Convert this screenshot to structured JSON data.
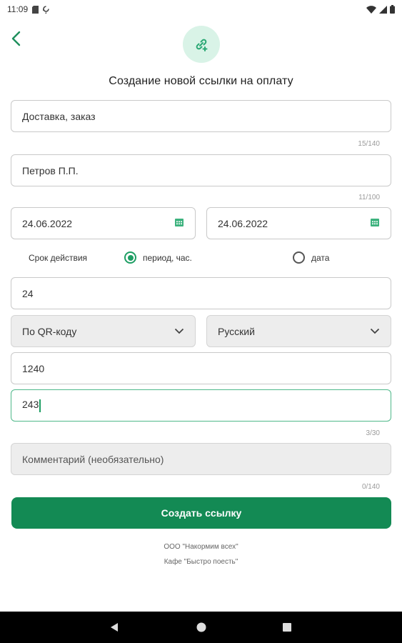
{
  "status_bar": {
    "time": "11:09"
  },
  "header": {
    "title": "Создание новой ссылки на оплату"
  },
  "form": {
    "purpose": {
      "value": "Доставка, заказ",
      "counter": "15/140"
    },
    "payer": {
      "value": "Петров П.П.",
      "counter": "11/100"
    },
    "date_from": {
      "value": "24.06.2022"
    },
    "date_to": {
      "value": "24.06.2022"
    },
    "validity": {
      "label": "Срок действия",
      "option_period": "период, час.",
      "option_date": "дата",
      "selected": "period"
    },
    "hours": {
      "value": "24"
    },
    "method_select": {
      "value": "По QR-коду"
    },
    "language_select": {
      "value": "Русский"
    },
    "amount": {
      "value": "1240"
    },
    "order_number": {
      "value": "243",
      "counter": "3/30"
    },
    "comment": {
      "placeholder": "Комментарий (необязательно)",
      "counter": "0/140"
    }
  },
  "submit": {
    "label": "Создать ссылку"
  },
  "footer": {
    "company": "ООО \"Накормим всех\"",
    "shop": "Кафе \"Быстро поесть\""
  },
  "colors": {
    "accent": "#138a54",
    "accent_light": "#d9f3e7",
    "focus": "#4fb88a"
  }
}
